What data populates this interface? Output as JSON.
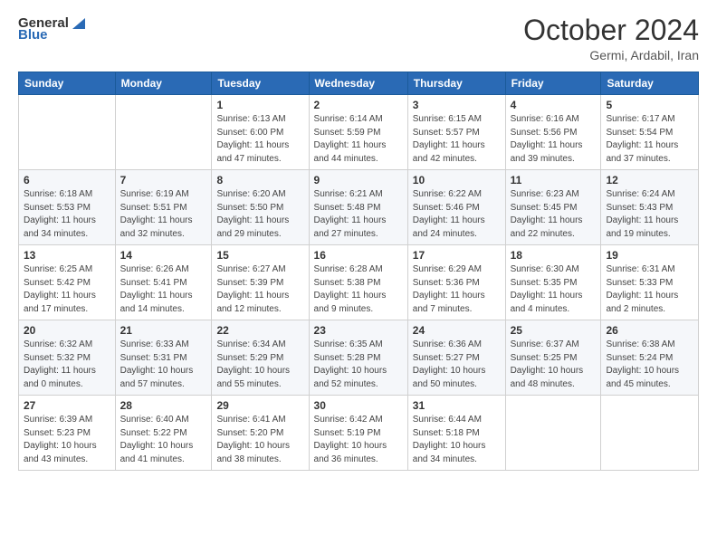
{
  "header": {
    "logo_general": "General",
    "logo_blue": "Blue",
    "month_title": "October 2024",
    "location": "Germi, Ardabil, Iran"
  },
  "days_of_week": [
    "Sunday",
    "Monday",
    "Tuesday",
    "Wednesday",
    "Thursday",
    "Friday",
    "Saturday"
  ],
  "weeks": [
    [
      {
        "day": "",
        "info": ""
      },
      {
        "day": "",
        "info": ""
      },
      {
        "day": "1",
        "info": "Sunrise: 6:13 AM\nSunset: 6:00 PM\nDaylight: 11 hours and 47 minutes."
      },
      {
        "day": "2",
        "info": "Sunrise: 6:14 AM\nSunset: 5:59 PM\nDaylight: 11 hours and 44 minutes."
      },
      {
        "day": "3",
        "info": "Sunrise: 6:15 AM\nSunset: 5:57 PM\nDaylight: 11 hours and 42 minutes."
      },
      {
        "day": "4",
        "info": "Sunrise: 6:16 AM\nSunset: 5:56 PM\nDaylight: 11 hours and 39 minutes."
      },
      {
        "day": "5",
        "info": "Sunrise: 6:17 AM\nSunset: 5:54 PM\nDaylight: 11 hours and 37 minutes."
      }
    ],
    [
      {
        "day": "6",
        "info": "Sunrise: 6:18 AM\nSunset: 5:53 PM\nDaylight: 11 hours and 34 minutes."
      },
      {
        "day": "7",
        "info": "Sunrise: 6:19 AM\nSunset: 5:51 PM\nDaylight: 11 hours and 32 minutes."
      },
      {
        "day": "8",
        "info": "Sunrise: 6:20 AM\nSunset: 5:50 PM\nDaylight: 11 hours and 29 minutes."
      },
      {
        "day": "9",
        "info": "Sunrise: 6:21 AM\nSunset: 5:48 PM\nDaylight: 11 hours and 27 minutes."
      },
      {
        "day": "10",
        "info": "Sunrise: 6:22 AM\nSunset: 5:46 PM\nDaylight: 11 hours and 24 minutes."
      },
      {
        "day": "11",
        "info": "Sunrise: 6:23 AM\nSunset: 5:45 PM\nDaylight: 11 hours and 22 minutes."
      },
      {
        "day": "12",
        "info": "Sunrise: 6:24 AM\nSunset: 5:43 PM\nDaylight: 11 hours and 19 minutes."
      }
    ],
    [
      {
        "day": "13",
        "info": "Sunrise: 6:25 AM\nSunset: 5:42 PM\nDaylight: 11 hours and 17 minutes."
      },
      {
        "day": "14",
        "info": "Sunrise: 6:26 AM\nSunset: 5:41 PM\nDaylight: 11 hours and 14 minutes."
      },
      {
        "day": "15",
        "info": "Sunrise: 6:27 AM\nSunset: 5:39 PM\nDaylight: 11 hours and 12 minutes."
      },
      {
        "day": "16",
        "info": "Sunrise: 6:28 AM\nSunset: 5:38 PM\nDaylight: 11 hours and 9 minutes."
      },
      {
        "day": "17",
        "info": "Sunrise: 6:29 AM\nSunset: 5:36 PM\nDaylight: 11 hours and 7 minutes."
      },
      {
        "day": "18",
        "info": "Sunrise: 6:30 AM\nSunset: 5:35 PM\nDaylight: 11 hours and 4 minutes."
      },
      {
        "day": "19",
        "info": "Sunrise: 6:31 AM\nSunset: 5:33 PM\nDaylight: 11 hours and 2 minutes."
      }
    ],
    [
      {
        "day": "20",
        "info": "Sunrise: 6:32 AM\nSunset: 5:32 PM\nDaylight: 11 hours and 0 minutes."
      },
      {
        "day": "21",
        "info": "Sunrise: 6:33 AM\nSunset: 5:31 PM\nDaylight: 10 hours and 57 minutes."
      },
      {
        "day": "22",
        "info": "Sunrise: 6:34 AM\nSunset: 5:29 PM\nDaylight: 10 hours and 55 minutes."
      },
      {
        "day": "23",
        "info": "Sunrise: 6:35 AM\nSunset: 5:28 PM\nDaylight: 10 hours and 52 minutes."
      },
      {
        "day": "24",
        "info": "Sunrise: 6:36 AM\nSunset: 5:27 PM\nDaylight: 10 hours and 50 minutes."
      },
      {
        "day": "25",
        "info": "Sunrise: 6:37 AM\nSunset: 5:25 PM\nDaylight: 10 hours and 48 minutes."
      },
      {
        "day": "26",
        "info": "Sunrise: 6:38 AM\nSunset: 5:24 PM\nDaylight: 10 hours and 45 minutes."
      }
    ],
    [
      {
        "day": "27",
        "info": "Sunrise: 6:39 AM\nSunset: 5:23 PM\nDaylight: 10 hours and 43 minutes."
      },
      {
        "day": "28",
        "info": "Sunrise: 6:40 AM\nSunset: 5:22 PM\nDaylight: 10 hours and 41 minutes."
      },
      {
        "day": "29",
        "info": "Sunrise: 6:41 AM\nSunset: 5:20 PM\nDaylight: 10 hours and 38 minutes."
      },
      {
        "day": "30",
        "info": "Sunrise: 6:42 AM\nSunset: 5:19 PM\nDaylight: 10 hours and 36 minutes."
      },
      {
        "day": "31",
        "info": "Sunrise: 6:44 AM\nSunset: 5:18 PM\nDaylight: 10 hours and 34 minutes."
      },
      {
        "day": "",
        "info": ""
      },
      {
        "day": "",
        "info": ""
      }
    ]
  ]
}
